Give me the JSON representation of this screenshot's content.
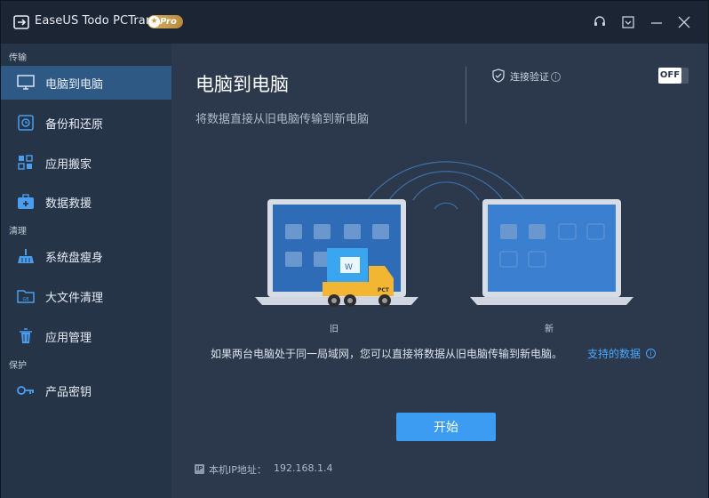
{
  "app": {
    "title": "EaseUS Todo PCTrans",
    "badge": "Pro"
  },
  "titlebar": {
    "icons": [
      "support-icon",
      "minimize-to-tray-icon",
      "minimize-icon",
      "close-icon"
    ]
  },
  "sidebar": {
    "sections": [
      {
        "label": "传输"
      },
      {
        "label": "清理"
      },
      {
        "label": "保护"
      }
    ],
    "items": [
      {
        "label": "电脑到电脑",
        "icon": "monitor-icon",
        "active": true
      },
      {
        "label": "备份和还原",
        "icon": "backup-icon"
      },
      {
        "label": "应用搬家",
        "icon": "apps-icon"
      },
      {
        "label": "数据救援",
        "icon": "rescue-icon"
      },
      {
        "label": "系统盘瘦身",
        "icon": "broom-icon"
      },
      {
        "label": "大文件清理",
        "icon": "folder-icon"
      },
      {
        "label": "应用管理",
        "icon": "trash-icon"
      },
      {
        "label": "产品密钥",
        "icon": "key-icon"
      }
    ]
  },
  "main": {
    "title": "电脑到电脑",
    "subtitle": "将数据直接从旧电脑传输到新电脑",
    "connection_verify_label": "连接验证",
    "toggle_label": "OFF",
    "old_label": "旧",
    "new_label": "新",
    "description": "如果两台电脑处于同一局域网，您可以直接将数据从旧电脑传输到新电脑。",
    "supported_link": "支持的数据",
    "start_button": "开始",
    "ip_label": "本机IP地址：",
    "ip_value": "192.168.1.4",
    "ip_badge": "IP",
    "truck_text": "PCT",
    "colors": {
      "accent": "#3b9cf2",
      "sidebar_active": "#2e5984",
      "link": "#4aa8ff"
    }
  }
}
